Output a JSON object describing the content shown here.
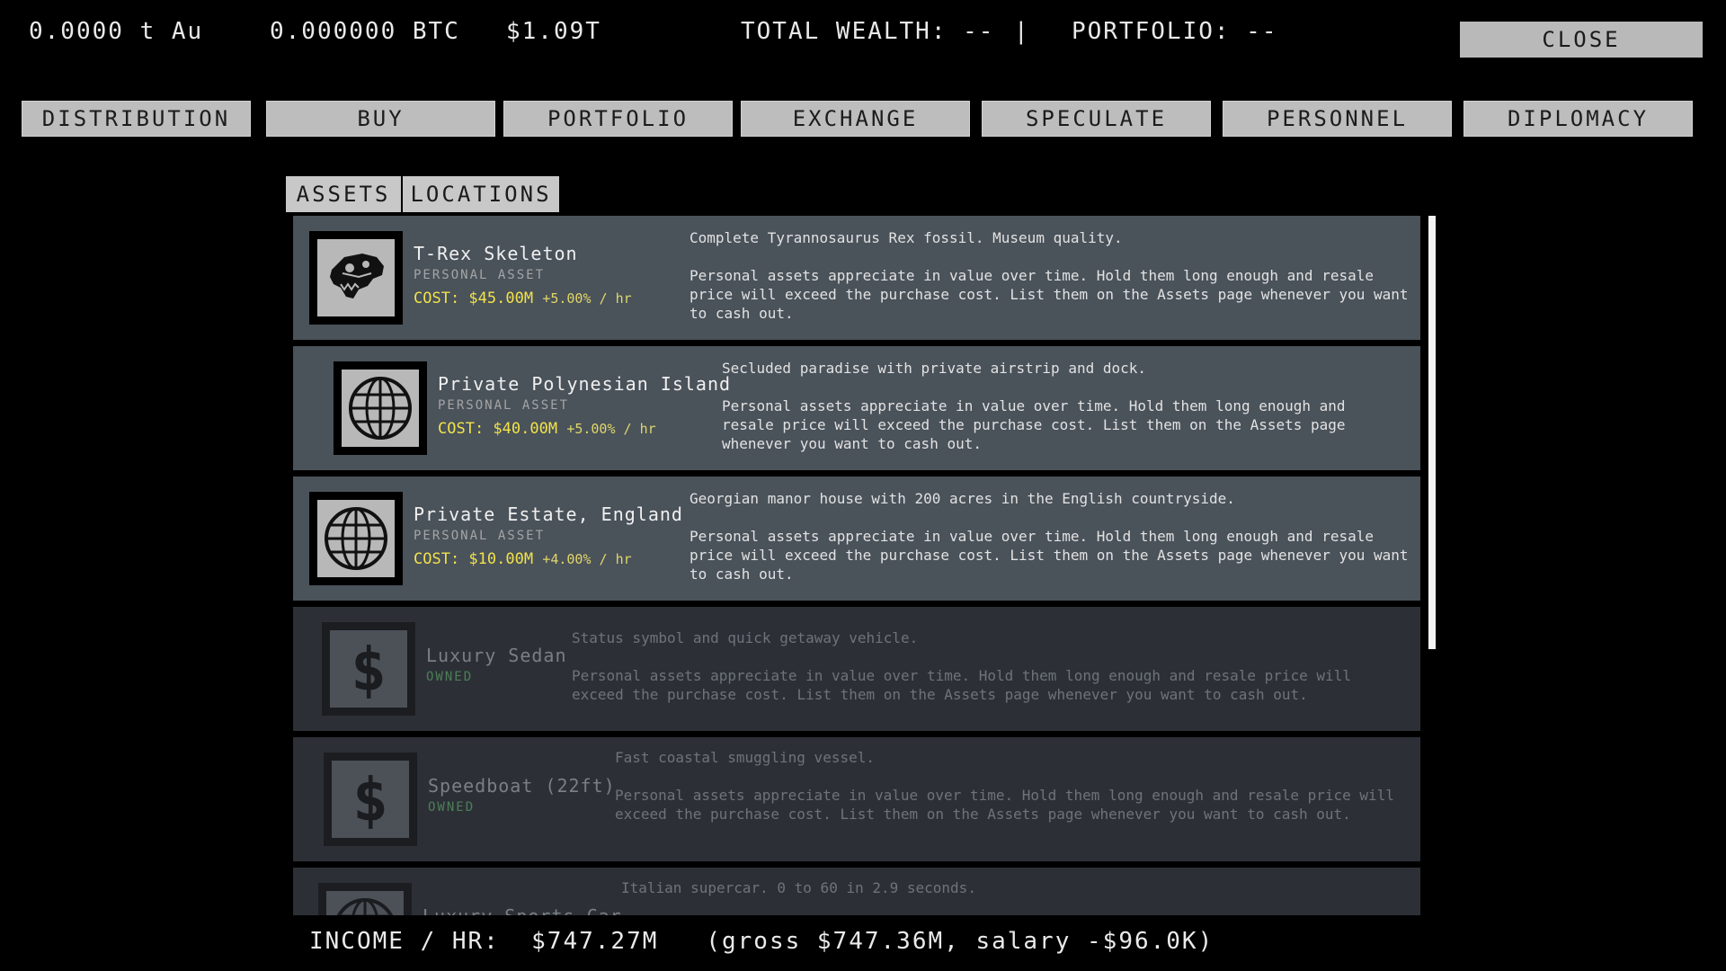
{
  "header": {
    "gold": "0.0000 t Au",
    "btc": "0.000000 BTC",
    "cash": "$1.09T",
    "total_wealth": "TOTAL WEALTH: --",
    "separator": "|",
    "portfolio": "PORTFOLIO: --",
    "close_label": "CLOSE"
  },
  "nav": [
    {
      "label": "DISTRIBUTION"
    },
    {
      "label": "BUY"
    },
    {
      "label": "PORTFOLIO"
    },
    {
      "label": "EXCHANGE"
    },
    {
      "label": "SPECULATE"
    },
    {
      "label": "PERSONNEL"
    },
    {
      "label": "DIPLOMACY"
    }
  ],
  "subtabs": [
    {
      "label": "ASSETS"
    },
    {
      "label": "LOCATIONS"
    }
  ],
  "assets": [
    {
      "name": "T-Rex Skeleton",
      "tag": "PERSONAL ASSET",
      "cost": "COST: $45.00M",
      "rate": "+5.00% / hr",
      "icon": "dinosaur-skull-icon",
      "desc1": "Complete Tyrannosaurus Rex fossil. Museum quality.",
      "desc2": "Personal assets appreciate in value over time. Hold them long enough and resale price will exceed the purchase cost. List them on the Assets page whenever you want to cash out."
    },
    {
      "name": "Private Polynesian Island",
      "tag": "PERSONAL ASSET",
      "cost": "COST: $40.00M",
      "rate": "+5.00% / hr",
      "icon": "globe-icon",
      "desc1": "Secluded paradise with private airstrip and dock.",
      "desc2": "Personal assets appreciate in value over time. Hold them long enough and resale price will exceed the purchase cost. List them on the Assets page whenever you want to cash out."
    },
    {
      "name": "Private Estate, England",
      "tag": "PERSONAL ASSET",
      "cost": "COST: $10.00M",
      "rate": "+4.00% / hr",
      "icon": "globe-icon",
      "desc1": "Georgian manor house with 200 acres in the English countryside.",
      "desc2": "Personal assets appreciate in value over time. Hold them long enough and resale price will exceed the purchase cost. List them on the Assets page whenever you want to cash out."
    },
    {
      "name": "Luxury Sedan",
      "tag": "OWNED",
      "icon": "dollar-icon",
      "desc1": "Status symbol and quick getaway vehicle.",
      "desc2": "Personal assets appreciate in value over time. Hold them long enough and resale price will exceed the purchase cost. List them on the Assets page whenever you want to cash out."
    },
    {
      "name": "Speedboat (22ft)",
      "tag": "OWNED",
      "icon": "dollar-icon",
      "desc1": "Fast coastal smuggling vessel.",
      "desc2": "Personal assets appreciate in value over time. Hold them long enough and resale price will exceed the purchase cost. List them on the Assets page whenever you want to cash out."
    },
    {
      "name": "Luxury Sports Car",
      "icon": "globe-icon",
      "desc1": "Italian supercar. 0 to 60 in 2.9 seconds."
    }
  ],
  "footer": {
    "income": "INCOME / HR:  $747.27M   (gross $747.36M, salary -$96.0K)"
  },
  "colors": {
    "cost": "#f1e24a",
    "card": "#4a525a",
    "owned_card": "#2c3036",
    "owned_tag": "#4e7e58"
  }
}
